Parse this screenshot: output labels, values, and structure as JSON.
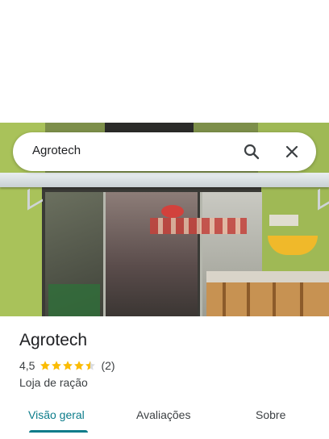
{
  "search": {
    "query": "Agrotech"
  },
  "place": {
    "name": "Agrotech",
    "rating": "4,5",
    "rating_value": 4.5,
    "review_count": "(2)",
    "category": "Loja de ração"
  },
  "tabs": [
    {
      "label": "Visão geral",
      "active": true
    },
    {
      "label": "Avaliações",
      "active": false
    },
    {
      "label": "Sobre",
      "active": false
    }
  ],
  "colors": {
    "accent": "#0b7c8a",
    "star": "#fbbc04"
  },
  "icons": {
    "search": "search-icon",
    "close": "close-icon"
  }
}
